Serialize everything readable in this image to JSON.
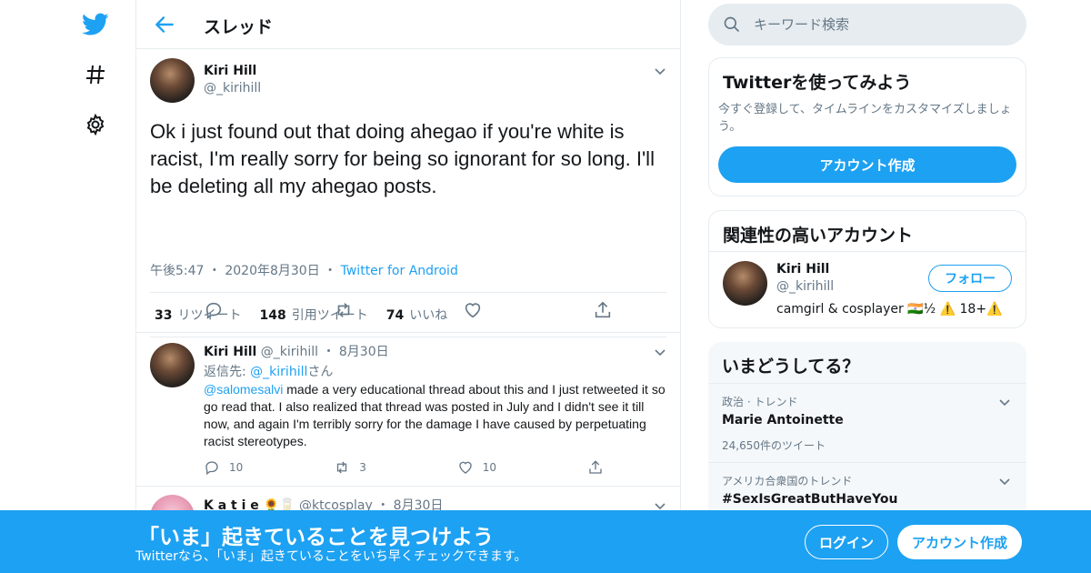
{
  "header": {
    "title": "スレッド"
  },
  "main_tweet": {
    "name": "Kiri Hill",
    "handle": "@_kirihill",
    "text": "Ok i just found out that doing ahegao if you're white is racist, I'm really sorry for being so ignorant for so long. I'll be deleting all my ahegao posts.",
    "time": "午後5:47",
    "date": "2020年8月30日",
    "source": "Twitter for Android",
    "retweets_count": "33",
    "retweets_label": "リツイート",
    "quotes_count": "148",
    "quotes_label": "引用ツイート",
    "likes_count": "74",
    "likes_label": "いいね"
  },
  "reply": {
    "name": "Kiri Hill",
    "handle": "@_kirihill",
    "date": "8月30日",
    "replying_prefix": "返信先: ",
    "replying_to": "@_kirihill",
    "replying_suffix": "さん",
    "mention": "@salomesalvi",
    "text": " made a very educational thread about this and I just retweeted it so go read that. I also realized that thread was posted in July and I didn't see it till now, and again I'm terribly sorry for the damage I have caused by perpetuating racist stereotypes.",
    "replies": "10",
    "retweets": "3",
    "likes": "10"
  },
  "reply2": {
    "name": "K a t i e 🌻🥛",
    "handle": "@ktcosplay",
    "date": "8月30日"
  },
  "search": {
    "placeholder": "キーワード検索"
  },
  "signup_card": {
    "title": "Twitterを使ってみよう",
    "subtitle": "今すぐ登録して、タイムラインをカスタマイズしましょう。",
    "button": "アカウント作成"
  },
  "related_card": {
    "title": "関連性の高いアカウント",
    "name": "Kiri Hill",
    "handle": "@_kirihill",
    "bio": "camgirl & cosplayer 🇮🇳½ ⚠️ 18+⚠️",
    "follow": "フォロー"
  },
  "trends": {
    "title": "いまどうしてる？",
    "items": [
      {
        "category": "政治 · トレンド",
        "name": "Marie Antoinette",
        "count": "24,650件のツイート"
      },
      {
        "category": "アメリカ合衆国のトレンド",
        "name": "#SexIsGreatButHaveYou",
        "count": ""
      }
    ]
  },
  "bottom_bar": {
    "title": "「いま」起きていることを見つけよう",
    "subtitle": "Twitterなら、「いま」起きていることをいち早くチェックできます。",
    "login": "ログイン",
    "signup": "アカウント作成"
  },
  "colors": {
    "accent": "#1da1f2",
    "muted": "#657786",
    "border": "#e6ecf0"
  },
  "icons": [
    "twitter-logo-icon",
    "hashtag-icon",
    "gear-icon",
    "back-arrow-icon",
    "chevron-down-icon",
    "reply-icon",
    "retweet-icon",
    "like-icon",
    "share-icon",
    "search-icon"
  ]
}
